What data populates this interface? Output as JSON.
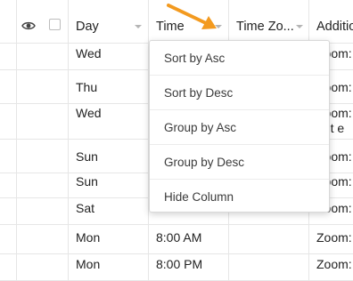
{
  "columns": {
    "visibility_icon": "eye-icon",
    "day": "Day",
    "time": "Time",
    "time_zone": "Time Zo...",
    "additional": "Additio"
  },
  "rows": [
    {
      "day": "Wed",
      "time": "",
      "zone": "",
      "extra": "Zoom:"
    },
    {
      "day": "Thu",
      "time": "",
      "zone": "",
      "extra": "Zoom:"
    },
    {
      "day": "Wed",
      "time": "",
      "zone": "",
      "extra": "Zoom:",
      "extra2": "ont e"
    },
    {
      "day": "Sun",
      "time": "",
      "zone": "",
      "extra": "Zoom:"
    },
    {
      "day": "Sun",
      "time": "",
      "zone": "",
      "extra": "Zoom:"
    },
    {
      "day": "Sat",
      "time": "",
      "zone": "",
      "extra": "Zoom:"
    },
    {
      "day": "Mon",
      "time": "8:00 AM",
      "zone": "",
      "extra": "Zoom:"
    },
    {
      "day": "Mon",
      "time": "8:00 PM",
      "zone": "",
      "extra": "Zoom:"
    }
  ],
  "menu": {
    "items": [
      "Sort by Asc",
      "Sort by Desc",
      "Group by Asc",
      "Group by Desc",
      "Hide Column"
    ]
  },
  "colors": {
    "arrow": "#f39a1f",
    "border": "#e6e6e6",
    "caret": "#b5b5b5"
  }
}
